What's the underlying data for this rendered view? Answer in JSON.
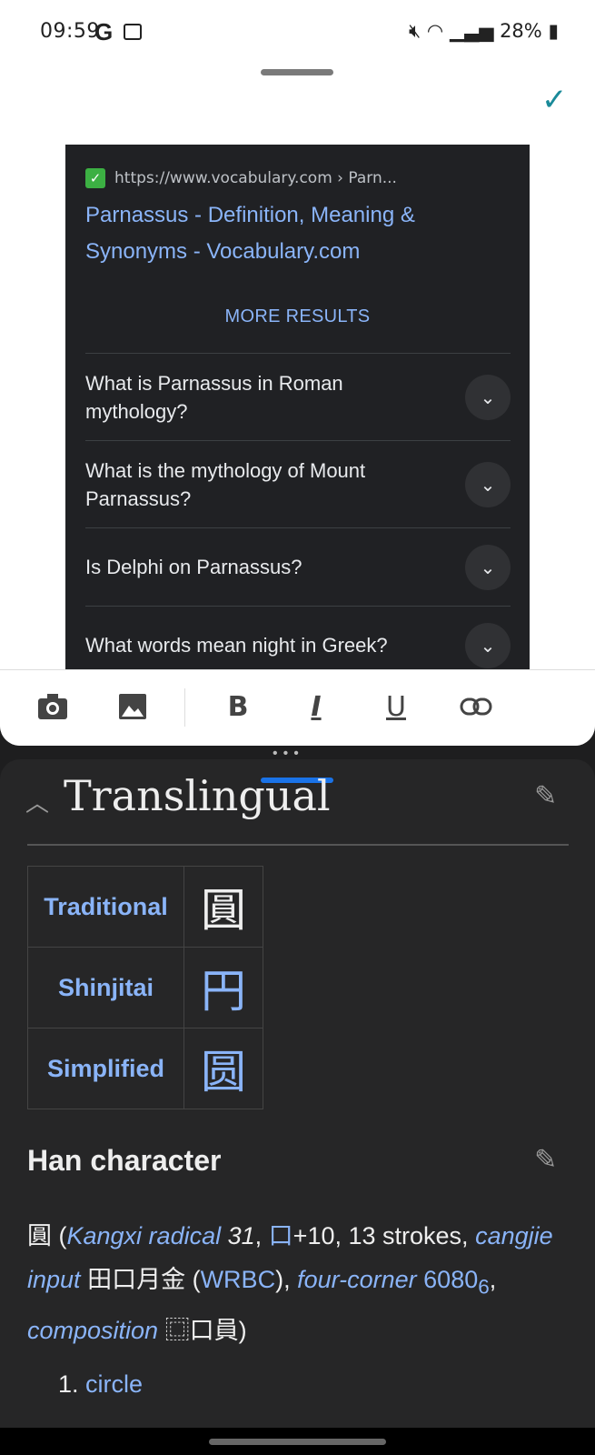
{
  "status_bar": {
    "time": "09:59",
    "notification_icons": [
      "google-icon",
      "gallery-icon"
    ],
    "battery": "28%",
    "system_icons": [
      "mute-icon",
      "wifi-icon",
      "signal-icon",
      "battery-icon"
    ]
  },
  "top_sheet": {
    "confirm_icon": "check-icon",
    "preview": {
      "url": "https://www.vocabulary.com › Parn...",
      "title": "Parnassus - Definition, Meaning & Synonyms - Vocabulary.com",
      "more_results": "MORE RESULTS",
      "questions": [
        "What is Parnassus in Roman mythology?",
        "What is the mythology of Mount Parnassus?",
        "Is Delphi on Parnassus?",
        "What words mean night in Greek?"
      ]
    },
    "toolbar": [
      "camera-icon",
      "image-icon",
      "B",
      "I",
      "U",
      "link-icon"
    ]
  },
  "wiktionary": {
    "section_title": "Translingual",
    "variants": [
      {
        "label": "Traditional",
        "char": "圓"
      },
      {
        "label": "Shinjitai",
        "char": "円"
      },
      {
        "label": "Simplified",
        "char": "圆"
      }
    ],
    "han_heading": "Han character",
    "han_line": {
      "char": "圓",
      "kangxi_label": "Kangxi radical",
      "kangxi_num": "31",
      "radical": "口",
      "radical_rest": "+10, 13 strokes,",
      "cangjie_label": "cangjie input",
      "cangjie": "田口月金",
      "cangjie_code": "WRBC",
      "fourcorner_label": "four-corner",
      "fourcorner_code": "6080",
      "fourcorner_sub": "6",
      "composition_label": "composition",
      "composition": "⿴口員"
    },
    "definition_num": "1.",
    "definition": "circle"
  }
}
